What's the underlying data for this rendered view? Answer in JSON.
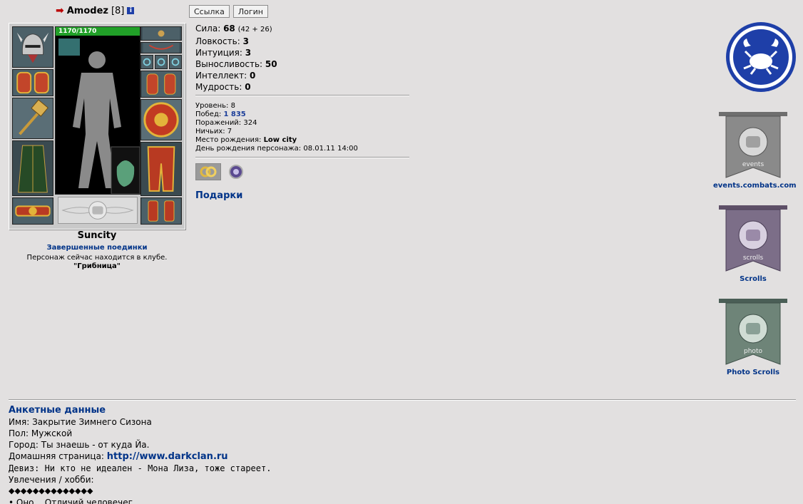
{
  "character": {
    "name": "Amodez",
    "level": "[8]",
    "hp": "1170/1170",
    "hp_fraction": 1.0,
    "city": "Suncity",
    "fights_link": "Завершенные поединки",
    "location_text": "Персонаж сейчас находится в клубе.",
    "club_name": "\"Грибница\""
  },
  "buttons": {
    "link": "Ссылка",
    "login": "Логин"
  },
  "stats": [
    {
      "label": "Сила:",
      "value": "68",
      "extra": "(42 + 26)"
    },
    {
      "label": "Ловкость:",
      "value": "3",
      "extra": ""
    },
    {
      "label": "Интуиция:",
      "value": "3",
      "extra": ""
    },
    {
      "label": "Выносливость:",
      "value": "50",
      "extra": ""
    },
    {
      "label": "Интеллект:",
      "value": "0",
      "extra": ""
    },
    {
      "label": "Мудрость:",
      "value": "0",
      "extra": ""
    }
  ],
  "info": {
    "level_label": "Уровень:",
    "level_value": "8",
    "wins_label": "Побед:",
    "wins_value": "1 835",
    "losses_label": "Поражений:",
    "losses_value": "324",
    "draws_label": "Ничьих:",
    "draws_value": "7",
    "birthplace_label": "Место рождения:",
    "birthplace_value": "Low city",
    "birthday_label": "День рождения персонажа:",
    "birthday_value": "08.01.11 14:00"
  },
  "gifts_link": "Подарки",
  "right_links": {
    "events_banner_text": "events",
    "events_link": "events.combats.com",
    "scrolls_banner_text": "scrolls",
    "scrolls_link": "Scrolls",
    "photo_banner_text": "photo",
    "photo_link": "Photo Scrolls"
  },
  "profile": {
    "title": "Анкетные данные",
    "name_line": "Имя: Закрытие Зимнего Сизона",
    "gender_line": "Пол: Мужской",
    "city_line": "Город: Ты знаешь - от куда Йа.",
    "homepage_label": "Домашняя страница:",
    "homepage_url": "http://www.darkclan.ru",
    "motto_line": "Девиз: Ни кто не идеален - Мона Лиза, тоже стареет.",
    "hobbies_label": "Увлечения / хобби:",
    "hobbies_decor": "◆◆◆◆◆◆◆◆◆◆◆◆◆◆",
    "hobbies_cut": "• Оно... Отличий человечег"
  },
  "colors": {
    "background": "#e2e0e0",
    "link": "#003388",
    "hp": "#21a028",
    "clan_blue": "#1e3fa8"
  }
}
